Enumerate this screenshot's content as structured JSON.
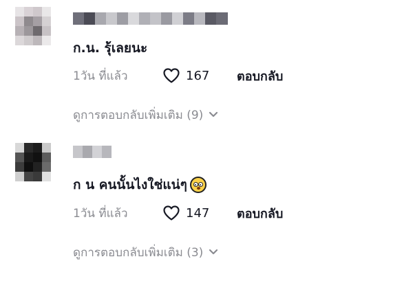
{
  "comments": [
    {
      "text": "ก.น. รุ้เลยนะ",
      "time": "1วัน ที่แล้ว",
      "likes": "167",
      "reply_label": "ตอบกลับ",
      "more_replies": "ดูการตอบกลับเพิ่มเติม (9)"
    },
    {
      "text": "ก น คนนั้นไงใช่แน่ๆ",
      "emoji": "flushed-face-emoji",
      "time": "1วัน ที่แล้ว",
      "likes": "147",
      "reply_label": "ตอบกลับ",
      "more_replies": "ดูการตอบกลับเพิ่มเติม (3)"
    }
  ],
  "colors": {
    "primary_text": "#161823",
    "secondary_text": "#8a8b91",
    "background": "#ffffff"
  },
  "icons": {
    "like": "heart-outline-icon",
    "expand": "chevron-down-icon"
  }
}
